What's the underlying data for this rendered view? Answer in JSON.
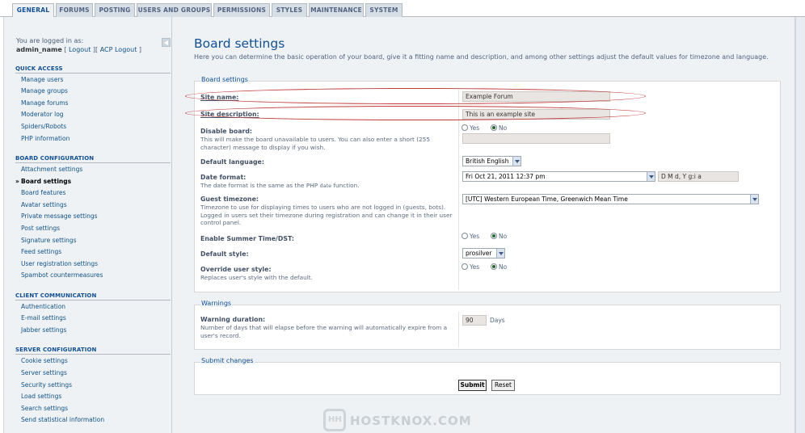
{
  "tabs": [
    "GENERAL",
    "FORUMS",
    "POSTING",
    "USERS AND GROUPS",
    "PERMISSIONS",
    "STYLES",
    "MAINTENANCE",
    "SYSTEM"
  ],
  "login": {
    "prefix": "You are logged in as:",
    "username": "admin_name",
    "logout": "Logout",
    "acp_logout": "ACP Logout"
  },
  "sidebar": {
    "quick_access": {
      "title": "QUICK ACCESS",
      "items": [
        "Manage users",
        "Manage groups",
        "Manage forums",
        "Moderator log",
        "Spiders/Robots",
        "PHP information"
      ]
    },
    "board_config": {
      "title": "BOARD CONFIGURATION",
      "items": [
        "Attachment settings",
        "Board settings",
        "Board features",
        "Avatar settings",
        "Private message settings",
        "Post settings",
        "Signature settings",
        "Feed settings",
        "User registration settings",
        "Spambot countermeasures"
      ]
    },
    "client_comm": {
      "title": "CLIENT COMMUNICATION",
      "items": [
        "Authentication",
        "E-mail settings",
        "Jabber settings"
      ]
    },
    "server_config": {
      "title": "SERVER CONFIGURATION",
      "items": [
        "Cookie settings",
        "Server settings",
        "Security settings",
        "Load settings",
        "Search settings",
        "Send statistical information"
      ]
    }
  },
  "page": {
    "title": "Board settings",
    "intro": "Here you can determine the basic operation of your board, give it a fitting name and description, and among other settings adjust the default values for timezone and language."
  },
  "board_settings": {
    "legend": "Board settings",
    "site_name": {
      "label": "Site name:",
      "value": "Example Forum"
    },
    "site_desc": {
      "label": "Site description:",
      "value": "This is an example site"
    },
    "disable_board": {
      "label": "Disable board:",
      "explain": "This will make the board unavailable to users. You can also enter a short (255 character) message to display if you wish.",
      "yes": "Yes",
      "no": "No",
      "selected": "No"
    },
    "default_lang": {
      "label": "Default language:",
      "value": "British English"
    },
    "date_format": {
      "label": "Date format:",
      "explain": "The date format is the same as the PHP",
      "explain_code": "date",
      "explain_end": "function.",
      "value": "Fri Oct 21, 2011 12:37 pm",
      "custom": "D M d, Y g:i a"
    },
    "timezone": {
      "label": "Guest timezone:",
      "explain": "Timezone to use for displaying times to users who are not logged in (guests, bots). Logged in users set their timezone during registration and can change it in their user control panel.",
      "value": "[UTC] Western European Time, Greenwich Mean Time"
    },
    "dst": {
      "label": "Enable Summer Time/DST:",
      "yes": "Yes",
      "no": "No",
      "selected": "No"
    },
    "default_style": {
      "label": "Default style:",
      "value": "prosilver"
    },
    "override_style": {
      "label": "Override user style:",
      "explain": "Replaces user's style with the default.",
      "yes": "Yes",
      "no": "No",
      "selected": "No"
    }
  },
  "warnings": {
    "legend": "Warnings",
    "duration": {
      "label": "Warning duration:",
      "explain": "Number of days that will elapse before the warning will automatically expire from a user's record.",
      "value": "90",
      "unit": "Days"
    }
  },
  "submit": {
    "legend": "Submit changes",
    "submit": "Submit",
    "reset": "Reset"
  },
  "watermark": "HOSTKNOX.COM",
  "colors": {
    "accent": "#115098",
    "link": "#105289",
    "highlight_ellipse": "#c03a3a"
  }
}
